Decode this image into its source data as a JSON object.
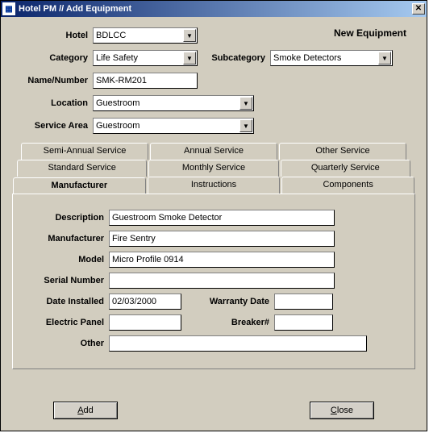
{
  "window": {
    "title": "Hotel PM // Add Equipment"
  },
  "header": {
    "new_equipment": "New Equipment"
  },
  "labels": {
    "hotel": "Hotel",
    "category": "Category",
    "subcategory": "Subcategory",
    "name_number": "Name/Number",
    "location": "Location",
    "service_area": "Service Area"
  },
  "values": {
    "hotel": "BDLCC",
    "category": "Life Safety",
    "subcategory": "Smoke Detectors",
    "name_number": "SMK-RM201",
    "location": "Guestroom",
    "service_area": "Guestroom"
  },
  "tabs": {
    "row_top": [
      "Semi-Annual Service",
      "Annual Service",
      "Other Service"
    ],
    "row_mid": [
      "Standard Service",
      "Monthly Service",
      "Quarterly Service"
    ],
    "row_bot": [
      "Manufacturer",
      "Instructions",
      "Components"
    ]
  },
  "mfr_panel": {
    "labels": {
      "description": "Description",
      "manufacturer": "Manufacturer",
      "model": "Model",
      "serial_number": "Serial Number",
      "date_installed": "Date Installed",
      "warranty_date": "Warranty Date",
      "electric_panel": "Electric Panel",
      "breaker": "Breaker#",
      "other": "Other"
    },
    "values": {
      "description": "Guestroom Smoke Detector",
      "manufacturer": "Fire Sentry",
      "model": "Micro Profile 0914",
      "serial_number": "",
      "date_installed": "02/03/2000",
      "warranty_date": "",
      "electric_panel": "",
      "breaker": "",
      "other": ""
    }
  },
  "buttons": {
    "add": "dd",
    "add_prefix": "A",
    "close": "lose",
    "close_prefix": "C"
  }
}
